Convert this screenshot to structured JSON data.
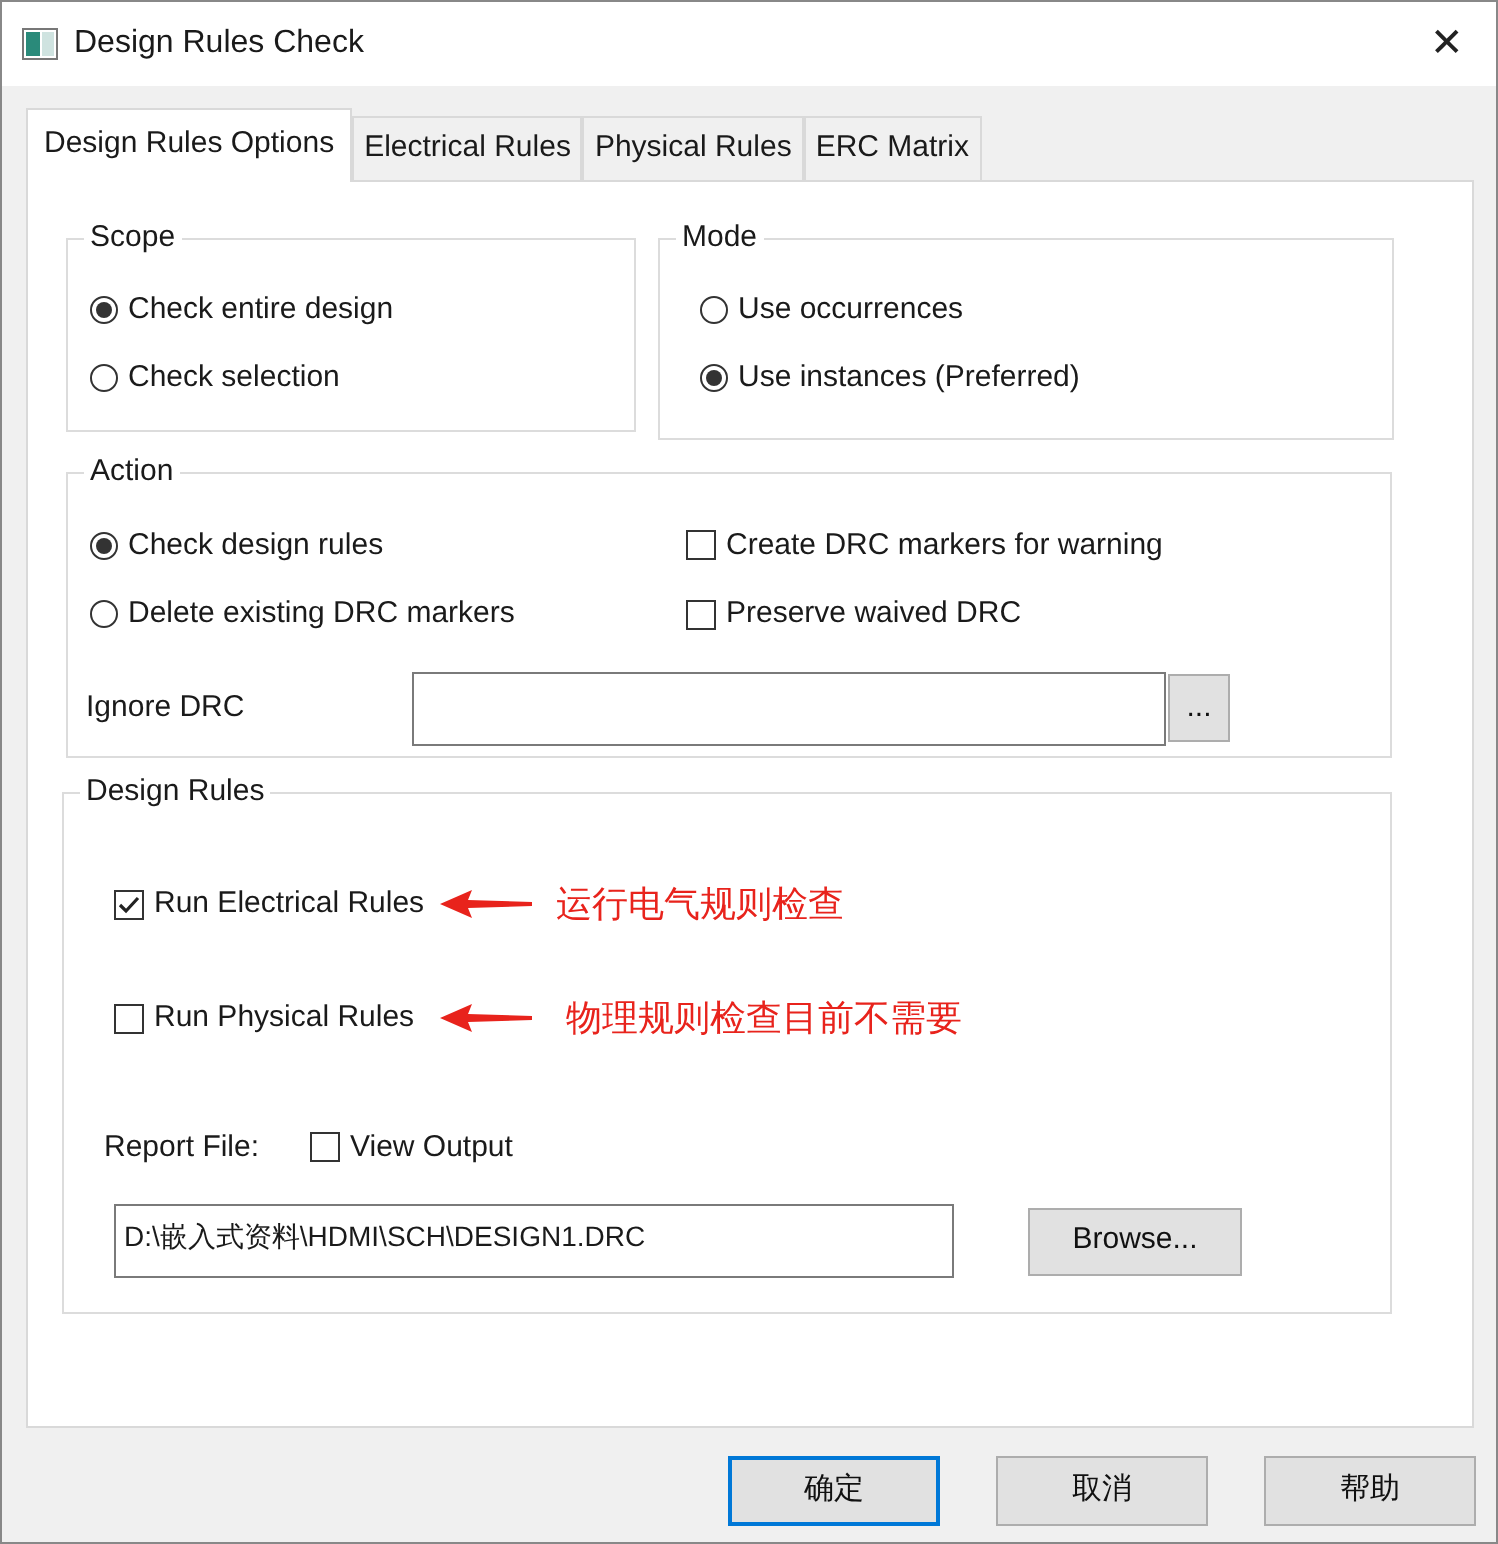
{
  "window": {
    "title": "Design Rules Check",
    "close": "✕"
  },
  "tabs": [
    {
      "label": "Design Rules Options",
      "selected": true
    },
    {
      "label": "Electrical Rules",
      "selected": false
    },
    {
      "label": "Physical Rules",
      "selected": false
    },
    {
      "label": "ERC Matrix",
      "selected": false
    }
  ],
  "scope": {
    "title": "Scope",
    "options": [
      {
        "label": "Check entire design",
        "selected": true
      },
      {
        "label": "Check selection",
        "selected": false
      }
    ]
  },
  "mode": {
    "title": "Mode",
    "options": [
      {
        "label": "Use occurrences",
        "selected": false
      },
      {
        "label": "Use instances (Preferred)",
        "selected": true
      }
    ]
  },
  "action": {
    "title": "Action",
    "options": [
      {
        "label": "Check design rules",
        "selected": true
      },
      {
        "label": "Delete existing DRC markers",
        "selected": false
      }
    ],
    "checkboxes": [
      {
        "label": "Create DRC markers for warning",
        "checked": false
      },
      {
        "label": "Preserve waived DRC",
        "checked": false
      }
    ],
    "ignore_label": "Ignore DRC",
    "ignore_button": "..."
  },
  "design_rules": {
    "title": "Design Rules",
    "rules": [
      {
        "label": "Run Electrical Rules",
        "checked": true,
        "note": "运行电气规则检查"
      },
      {
        "label": "Run Physical Rules",
        "checked": false,
        "note": "物理规则检查目前不需要"
      }
    ],
    "report_label": "Report File:",
    "view_output": {
      "label": "View Output",
      "checked": false
    },
    "report_path": "D:\\嵌入式资料\\HDMI\\SCH\\DESIGN1.DRC",
    "browse": "Browse..."
  },
  "buttons": [
    {
      "label": "确定",
      "default": true
    },
    {
      "label": "取消",
      "default": false
    },
    {
      "label": "帮助",
      "default": false
    }
  ]
}
